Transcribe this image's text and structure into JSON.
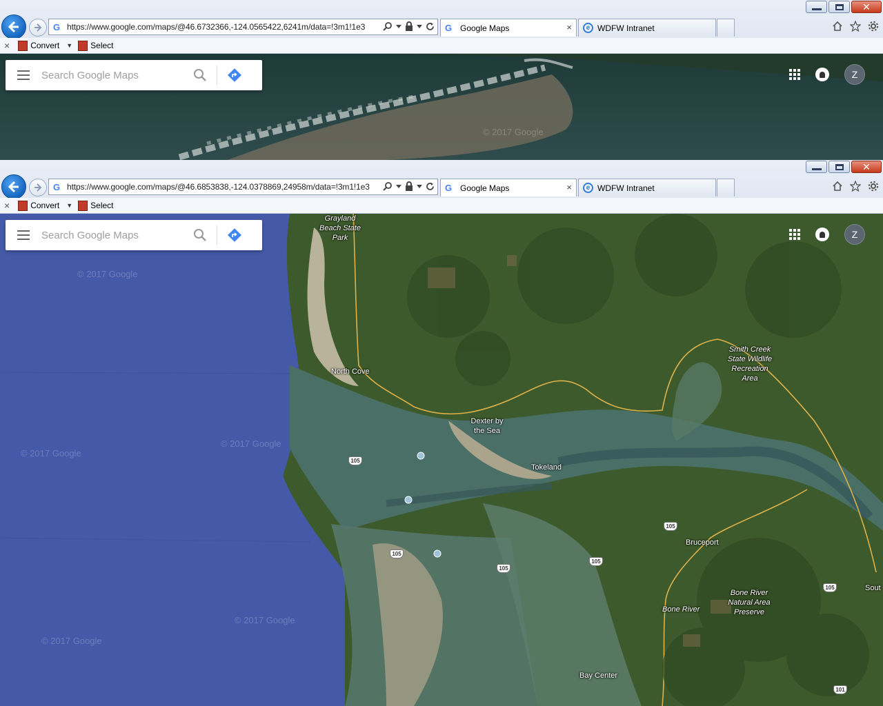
{
  "windows": [
    {
      "address": "https://www.google.com/maps/@46.6732366,-124.0565422,6241m/data=!3m1!1e3",
      "tabs": [
        {
          "label": "Google Maps",
          "close": "×"
        },
        {
          "label": "WDFW Intranet"
        }
      ],
      "commandbar": {
        "close": "×",
        "convert": "Convert",
        "select": "Select"
      },
      "map": {
        "search_placeholder": "Search Google Maps",
        "avatar": "Z",
        "watermark": "© 2017 Google"
      }
    },
    {
      "address": "https://www.google.com/maps/@46.6853838,-124.0378869,24958m/data=!3m1!1e3",
      "tabs": [
        {
          "label": "Google Maps",
          "close": "×"
        },
        {
          "label": "WDFW Intranet"
        }
      ],
      "commandbar": {
        "close": "×",
        "convert": "Convert",
        "select": "Select"
      },
      "map": {
        "search_placeholder": "Search Google Maps",
        "avatar": "Z",
        "watermark": "© 2017 Google",
        "places": {
          "grayland": "Grayland Beach State Park",
          "north_cove": "North Cove",
          "smith_creek": "Smith Creek State Wildlife Recreation Area",
          "dexter": "Dexter by the Sea",
          "tokeland": "Tokeland",
          "bruceport": "Bruceport",
          "bone_river_preserve": "Bone River Natural Area Preserve",
          "bone_river": "Bone River",
          "bay_center": "Bay Center",
          "south": "Sout"
        },
        "routes": {
          "r105": "105",
          "r101": "101"
        }
      }
    }
  ],
  "colors": {
    "ie_back_blue": "#1565c0",
    "maps_directions_blue": "#4285f4",
    "ocean": "#4459a8",
    "land": "#3d5a2c"
  }
}
